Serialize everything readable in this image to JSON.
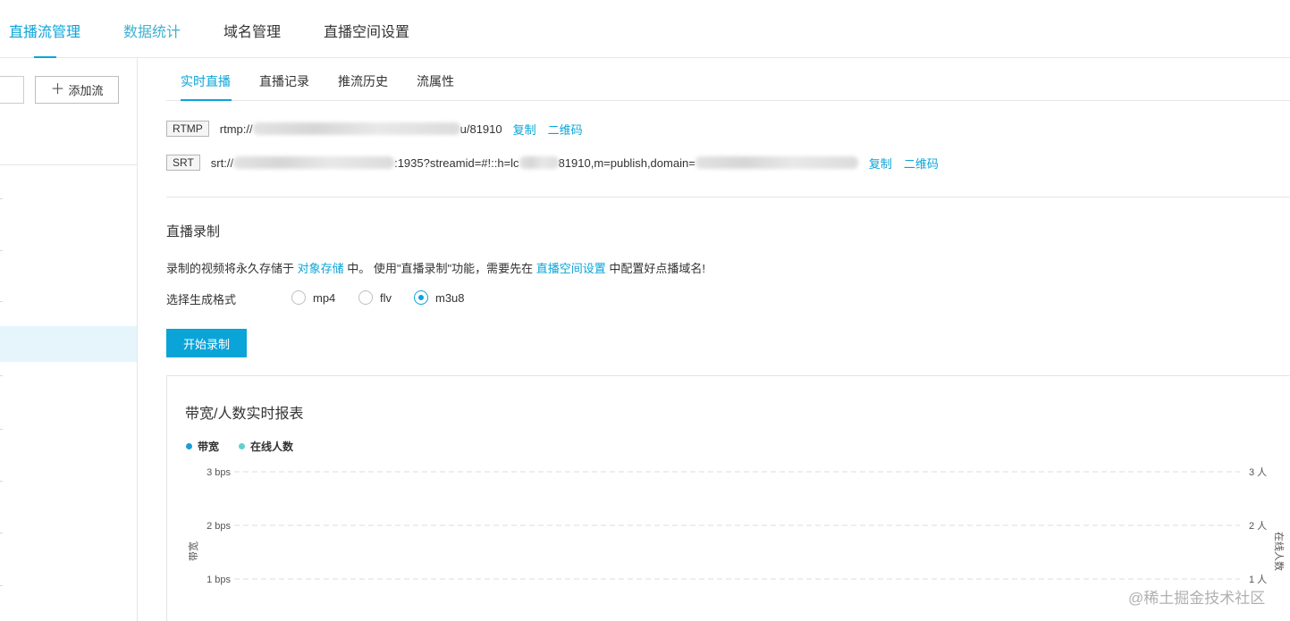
{
  "top_nav": {
    "tabs": [
      {
        "label": "直播流管理",
        "state": "active"
      },
      {
        "label": "数据统计",
        "state": "hover"
      },
      {
        "label": "域名管理",
        "state": "normal"
      },
      {
        "label": "直播空间设置",
        "state": "normal"
      }
    ]
  },
  "left_panel": {
    "add_stream_label": "添加流"
  },
  "sub_tabs": [
    {
      "label": "实时直播",
      "active": true
    },
    {
      "label": "直播记录",
      "active": false
    },
    {
      "label": "推流历史",
      "active": false
    },
    {
      "label": "流属性",
      "active": false
    }
  ],
  "rtmp": {
    "tag": "RTMP",
    "prefix": "rtmp://",
    "suffix": "u/81910",
    "copy": "复制",
    "qrcode": "二维码"
  },
  "srt": {
    "tag": "SRT",
    "prefix": "srt://",
    "part2": ":1935?streamid=#!::h=lc",
    "part3": "81910,m=publish,domain=",
    "copy": "复制",
    "qrcode": "二维码"
  },
  "recording": {
    "title": "直播录制",
    "desc_before": "录制的视频将永久存储于 ",
    "desc_link1": "对象存储",
    "desc_middle": " 中。 使用\"直播录制\"功能，需要先在 ",
    "desc_link2": "直播空间设置",
    "desc_after": " 中配置好点播域名!",
    "format_label": "选择生成格式",
    "formats": [
      {
        "label": "mp4",
        "selected": false
      },
      {
        "label": "flv",
        "selected": false
      },
      {
        "label": "m3u8",
        "selected": true
      }
    ],
    "start_button": "开始录制"
  },
  "chart_data": {
    "type": "line",
    "title": "带宽/人数实时报表",
    "legend": [
      {
        "name": "带宽",
        "color": "#1a9ed8"
      },
      {
        "name": "在线人数",
        "color": "#5fd0cf"
      }
    ],
    "y_left": {
      "label": "带宽",
      "ticks": [
        "3 bps",
        "2 bps",
        "1 bps"
      ],
      "range": [
        0,
        3
      ]
    },
    "y_right": {
      "label": "在线人数",
      "ticks": [
        "3 人",
        "2 人",
        "1 人"
      ],
      "range": [
        0,
        3
      ]
    },
    "series": [],
    "grid": true,
    "legend_position": "top-left"
  },
  "watermark": "@稀土掘金技术社区"
}
